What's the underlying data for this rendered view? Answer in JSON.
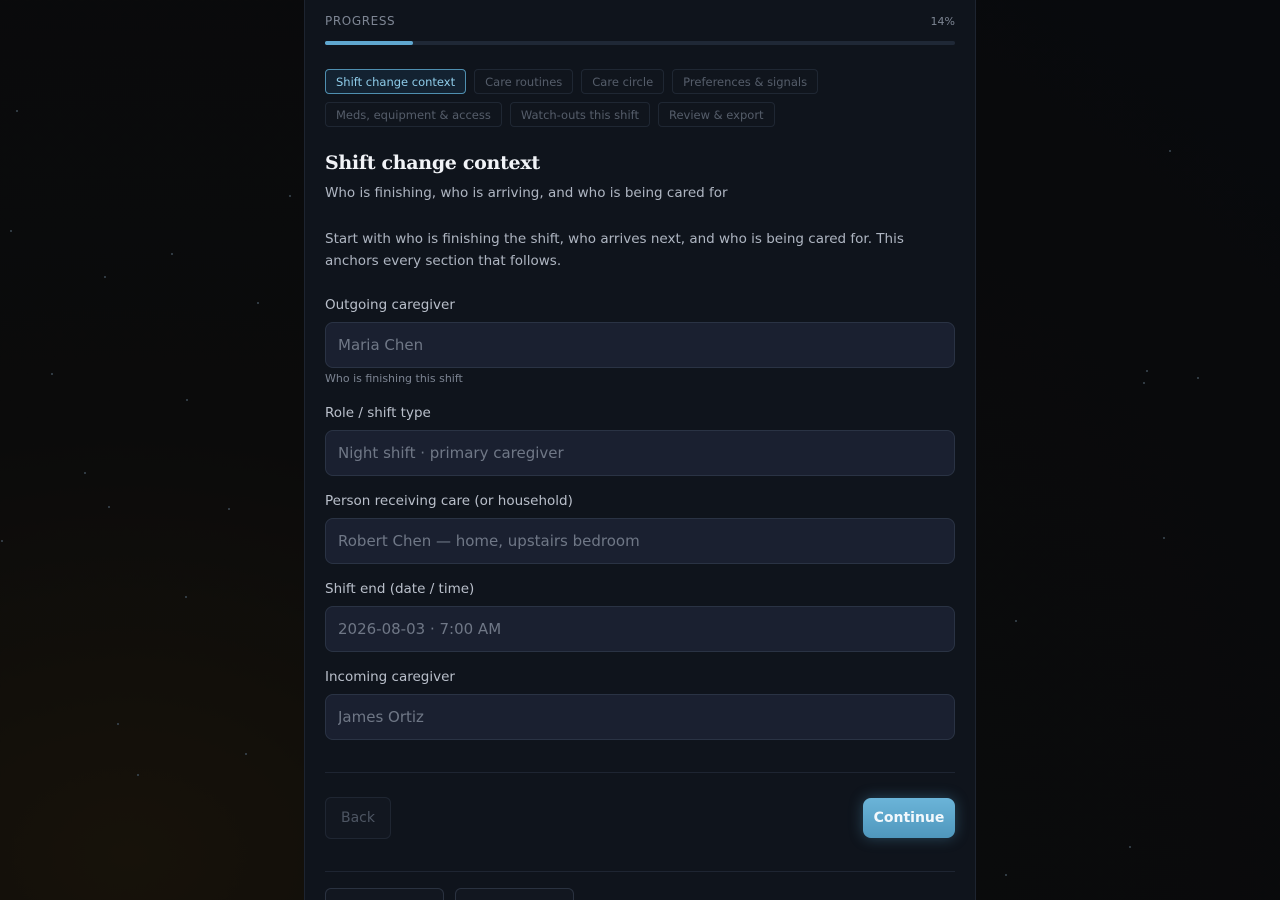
{
  "progress": {
    "label": "PROGRESS",
    "percent_text": "14%",
    "fraction": 0.14
  },
  "steps": [
    {
      "label": "Shift change context",
      "active": true
    },
    {
      "label": "Care routines",
      "active": false
    },
    {
      "label": "Care circle",
      "active": false
    },
    {
      "label": "Preferences & signals",
      "active": false
    },
    {
      "label": "Meds, equipment & access",
      "active": false
    },
    {
      "label": "Watch-outs this shift",
      "active": false
    },
    {
      "label": "Review & export",
      "active": false
    }
  ],
  "section": {
    "title": "Shift change context",
    "subtitle": "Who is finishing, who is arriving, and who is being cared for",
    "intro": "Start with who is finishing the shift, who arrives next, and who is being cared for. This anchors every section that follows."
  },
  "fields": {
    "outgoing": {
      "label": "Outgoing caregiver",
      "placeholder": "Maria Chen",
      "hint": "Who is finishing this shift"
    },
    "role": {
      "label": "Role / shift type",
      "placeholder": "Night shift · primary caregiver"
    },
    "person": {
      "label": "Person receiving care (or household)",
      "placeholder": "Robert Chen — home, upstairs bedroom"
    },
    "shift_end": {
      "label": "Shift end (date / time)",
      "placeholder": "2026-08-03 · 7:00 AM"
    },
    "incoming": {
      "label": "Incoming caregiver",
      "placeholder": "James Ortiz"
    }
  },
  "actions": {
    "back_label": "Back",
    "continue_label": "Continue"
  },
  "colors": {
    "accent": "#5fa7cf",
    "panel": "#0f141c",
    "input": "#1a2030"
  }
}
